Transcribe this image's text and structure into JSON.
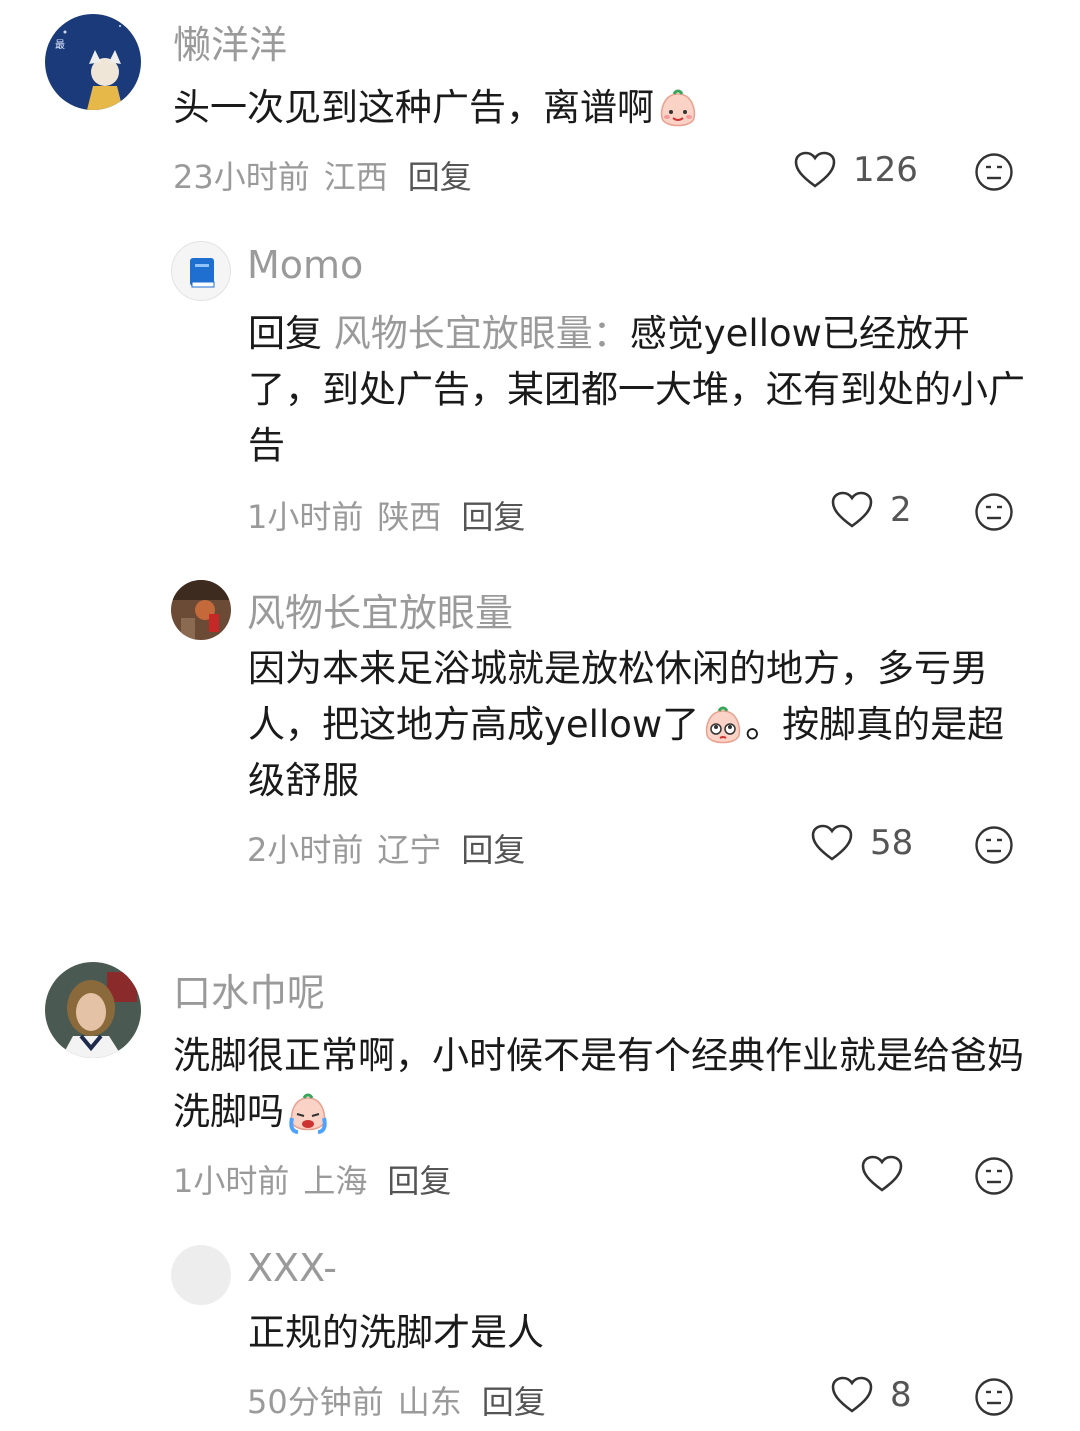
{
  "comments": [
    {
      "username": "懒洋洋",
      "text": "头一次见到这种广告，离谱啊",
      "time": "23小时前",
      "location": "江西",
      "reply_label": "回复",
      "likes": "126"
    },
    {
      "username": "Momo",
      "reply_prefix": "回复",
      "reply_target": "风物长宜放眼量：",
      "text": "感觉yellow已经放开了，到处广告，某团都一大堆，还有到处的小广告",
      "time": "1小时前",
      "location": "陕西",
      "reply_label": "回复",
      "likes": "2"
    },
    {
      "username": "风物长宜放眼量",
      "text_part1": "因为本来足浴城就是放松休闲的地方，多亏男人，把这地方高成yellow了",
      "text_part2": "。按脚真的是超级舒服",
      "time": "2小时前",
      "location": "辽宁",
      "reply_label": "回复",
      "likes": "58"
    },
    {
      "username": "口水巾呢",
      "text": "洗脚很正常啊，小时候不是有个经典作业就是给爸妈洗脚吗",
      "time": "1小时前",
      "location": "上海",
      "reply_label": "回复",
      "likes": ""
    },
    {
      "username": "XXX-",
      "text": "正规的洗脚才是人",
      "time": "50分钟前",
      "location": "山东",
      "reply_label": "回复",
      "likes": "8"
    }
  ],
  "icons": {
    "like": "heart-outline-icon",
    "dislike": "meh-face-icon"
  }
}
